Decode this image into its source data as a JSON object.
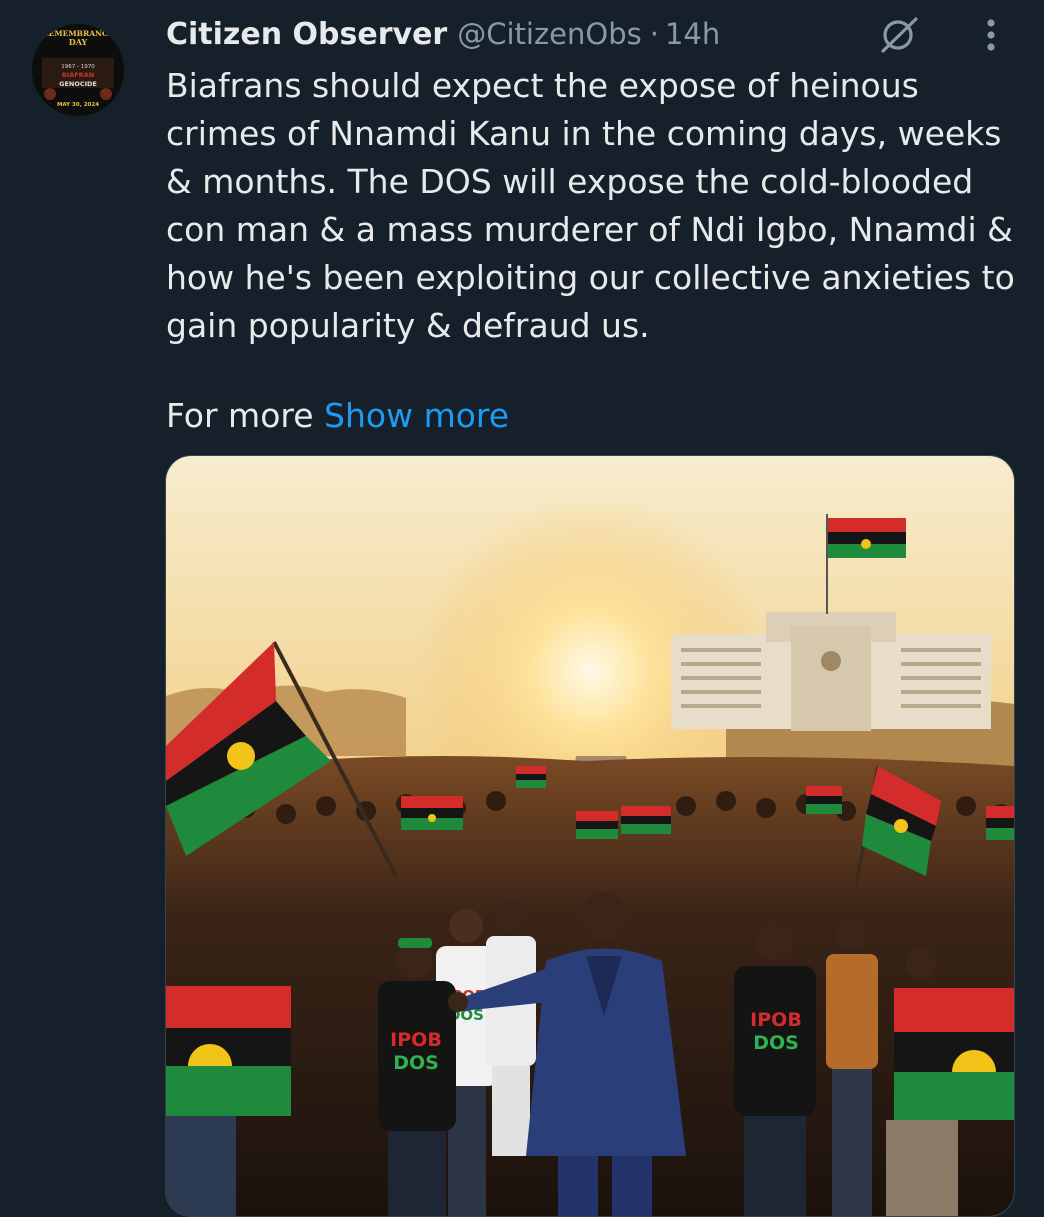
{
  "tweet": {
    "author_name": "Citizen Observer",
    "author_handle": "@CitizenObs",
    "separator": "·",
    "time": "14h",
    "paragraphs": [
      "Biafrans should expect the expose of heinous crimes of Nnamdi Kanu in the coming days, weeks & months. The DOS will expose the cold-blooded con man & a mass murderer of Ndi Igbo, Nnamdi & how he's been exploiting our collective anxieties to gain popularity & defraud us."
    ],
    "more_prefix": "For more",
    "show_more_label": "Show more"
  },
  "avatar": {
    "line1": "REMEMBRANCE",
    "line2": "DAY",
    "line3": "1967 - 1970",
    "line4": "BIAFRAN",
    "line5": "GENOCIDE",
    "line6": "MAY 30, 2024"
  },
  "media": {
    "shirt_line1": "IPOB",
    "shirt_line2": "DOS"
  },
  "icons": {
    "grok": "grok-icon",
    "more": "more-vertical-icon"
  },
  "colors": {
    "background": "#15202b",
    "text": "#e7e9ea",
    "secondary": "#8b98a5",
    "link": "#1d9bf0",
    "flag_red": "#d42b2b",
    "flag_black": "#151515",
    "flag_green": "#1f8a3b",
    "flag_sun": "#f2c318"
  }
}
